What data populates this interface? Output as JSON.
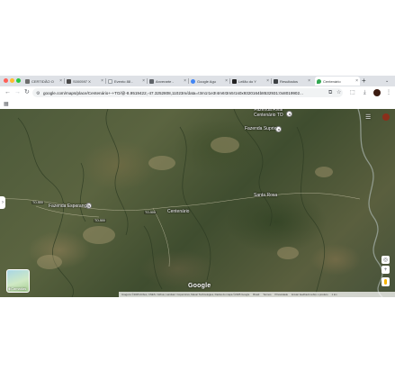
{
  "browser": {
    "tabs": [
      {
        "label": "CERTIDÃO O",
        "color": "#6d6d6d"
      },
      {
        "label": "S000597 X",
        "color": "#4a4a4a"
      },
      {
        "label": "Evento 88 -",
        "color": "#e8e8e8"
      },
      {
        "label": "Anverarte -",
        "color": "#5f6368"
      },
      {
        "label": "Google Agu",
        "color": "#4285f4"
      },
      {
        "label": "Leilão do Y",
        "color": "#222222"
      },
      {
        "label": "Resultados",
        "color": "#3c4043"
      },
      {
        "label": "Centenário",
        "color": "#34a853",
        "active": true
      }
    ],
    "new_tab": "+",
    "tab_menu": "⌄",
    "close_glyph": "×",
    "address": "google.com/maps/place/Centenário+-+TO/@-8.9519422,-47.3252808,11023m/data=!3m1!1e3!4m6!3m5!1s0x9320164b8532931:0x8019902..."
  },
  "toolbar": {
    "back": "←",
    "forward": "→",
    "reload": "↻"
  },
  "map": {
    "places": [
      {
        "label": "Fazenda Rival\nCentenário TO",
        "pin": true
      },
      {
        "label": "Fazenda Suprix",
        "pin": true
      },
      {
        "label": "Santa Rosa",
        "pin": false
      },
      {
        "label": "Fazenda Esperança",
        "pin": true
      },
      {
        "label": "Centenário",
        "pin": false
      }
    ],
    "roads": [
      "TO-500",
      "TO-500",
      "TO-500"
    ],
    "layers_label": "Camadas",
    "logo": "Google",
    "zoom_in": "+",
    "zoom_out": "−",
    "footer": [
      "Imagens ©2025 Airbus, CNES / Airbus, Landsat / Copernicus, Maxar Technologies, Dados do mapa ©2025 Google",
      "Brasil",
      "Termos",
      "Privacidade",
      "Enviar feedback sobre o produto",
      "1 km"
    ]
  }
}
